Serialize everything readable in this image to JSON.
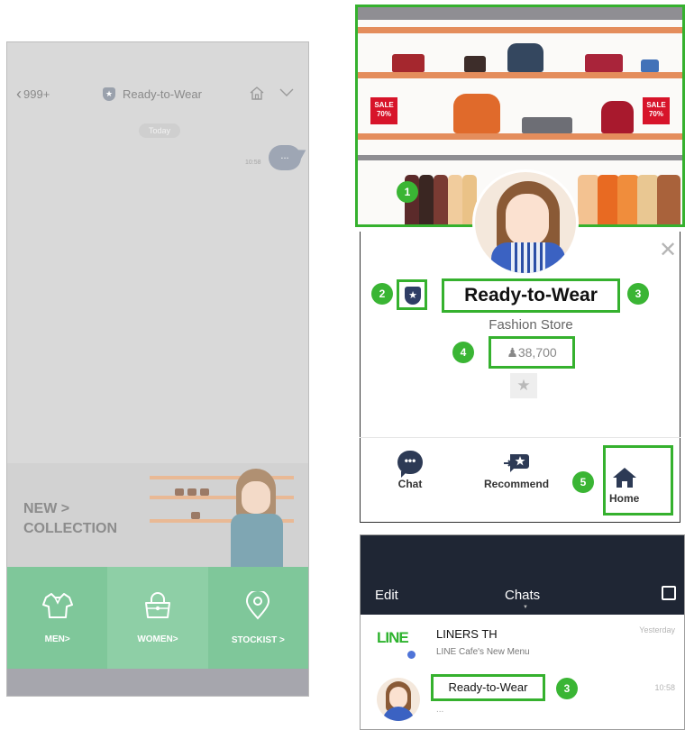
{
  "left_phone": {
    "back_count": "999+",
    "title": "Ready-to-Wear",
    "date_chip": "Today",
    "message_time": "10:58",
    "message_text": "...",
    "banner_line1": "NEW >",
    "banner_line2": "COLLECTION",
    "menu": [
      {
        "label": "MEN>",
        "icon": "shirt-icon"
      },
      {
        "label": "WOMEN>",
        "icon": "handbag-icon"
      },
      {
        "label": "STOCKIST >",
        "icon": "location-pin-icon"
      }
    ]
  },
  "store_image": {
    "sale_badge_1": {
      "line1": "SALE",
      "line2": "70%"
    },
    "sale_badge_2": {
      "line1": "SALE",
      "line2": "70%"
    }
  },
  "profile": {
    "name": "Ready-to-Wear",
    "category": "Fashion Store",
    "followers": "38,700",
    "actions": [
      {
        "label": "Chat",
        "icon": "chat-bubble-icon"
      },
      {
        "label": "Recommend",
        "icon": "recommend-icon"
      },
      {
        "label": "Home",
        "icon": "home-icon"
      }
    ]
  },
  "callouts": [
    "1",
    "2",
    "3",
    "4",
    "5",
    "3"
  ],
  "chats_screen": {
    "edit": "Edit",
    "title": "Chats",
    "rows": [
      {
        "name": "LINERS TH",
        "message": "LINE Cafe's New Menu",
        "time": "Yesterday",
        "logo": "LINE"
      },
      {
        "name": "Ready-to-Wear",
        "message": "...",
        "time": "10:58"
      }
    ]
  },
  "colors": {
    "highlight": "#35b12e",
    "callout": "#3ab534",
    "menu_green": "#7fc79a",
    "chats_header": "#1f2634",
    "sale_red": "#d7142a",
    "shelf_orange": "#e48d5c"
  }
}
